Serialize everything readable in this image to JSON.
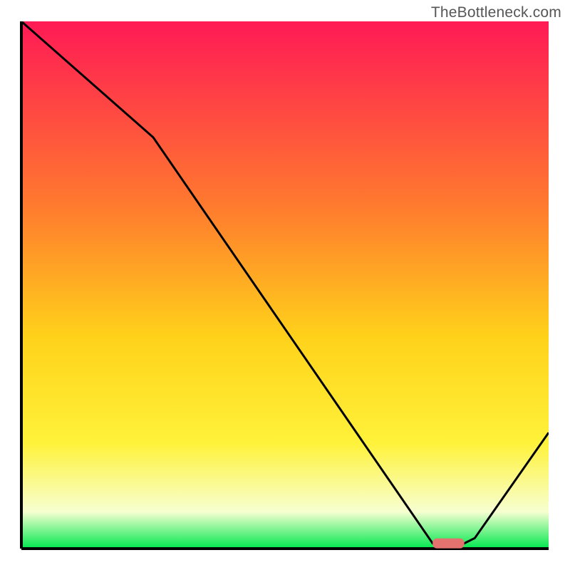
{
  "watermark": "TheBottleneck.com",
  "colors": {
    "gradient_top": "#ff1a55",
    "gradient_mid1": "#ff7a2e",
    "gradient_mid2": "#ffd21a",
    "gradient_mid3": "#fff23a",
    "gradient_bottom_soft": "#f7ffd1",
    "gradient_green": "#00e84e",
    "axis": "#000000",
    "curve": "#000000",
    "marker": "#e4736f"
  },
  "chart_data": {
    "type": "line",
    "title": "",
    "xlabel": "",
    "ylabel": "",
    "xlim": [
      0,
      100
    ],
    "ylim": [
      0,
      100
    ],
    "x": [
      0,
      25,
      78,
      84,
      86,
      100
    ],
    "values": [
      100,
      78,
      1,
      1,
      2,
      22
    ],
    "marker": {
      "x_start": 78,
      "x_end": 84,
      "y": 1
    },
    "grid": false,
    "legend": false
  }
}
